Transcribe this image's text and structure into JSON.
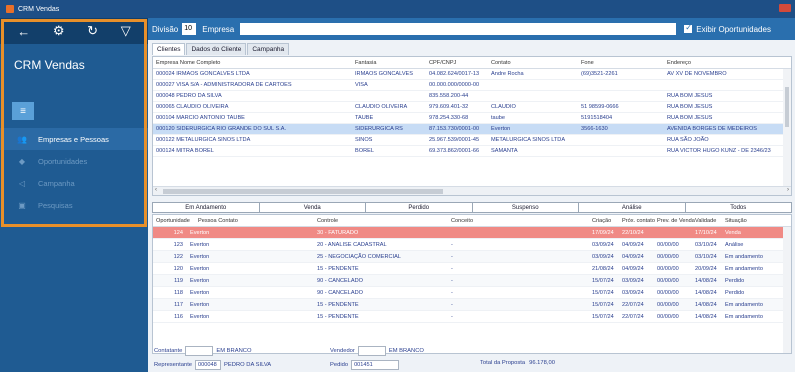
{
  "window": {
    "title": "CRM Vendas"
  },
  "sidebar": {
    "title": "CRM Vendas",
    "items": [
      {
        "label": "Empresas e Pessoas",
        "icon": "people-icon",
        "state": "active"
      },
      {
        "label": "Oportunidades",
        "icon": "diamond-icon",
        "state": "dim"
      },
      {
        "label": "Campanha",
        "icon": "megaphone-icon",
        "state": "dim"
      },
      {
        "label": "Pesquisas",
        "icon": "survey-icon",
        "state": "dim"
      }
    ]
  },
  "filters": {
    "divisao_label": "Divisão",
    "divisao_value": "10",
    "empresa_label": "Empresa",
    "exibir_label": "Exibir Oportunidades"
  },
  "tabs": [
    "Clientes",
    "Dados do Cliente",
    "Campanha"
  ],
  "clients": {
    "headers": [
      "Empresa Nome Completo",
      "Fantasia",
      "CPF/CNPJ",
      "Contato",
      "Fone",
      "Endereço"
    ],
    "rows": [
      [
        "000024  IRMAOS GONCALVES LTDA",
        "IRMAOS GONCALVES",
        "04.082.624/0017-13",
        "Andre Rocha",
        "(69)3521-2261",
        "AV XV DE NOVEMBRO"
      ],
      [
        "000027  VISA S/A - ADMINISTRADORA DE CARTOES",
        "VISA",
        "00.000.000/0000-00",
        "",
        "",
        ""
      ],
      [
        "000048  PEDRO DA SILVA",
        "",
        "835.558.200-44",
        "",
        "",
        "RUA BOM JESUS"
      ],
      [
        "000065  CLAUDIO OLIVEIRA",
        "CLAUDIO OLIVEIRA",
        "979.609.401-32",
        "CLAUDIO",
        "51 98599-0666",
        "RUA BOM JESUS"
      ],
      [
        "000104  MARCIO ANTONIO TAUBE",
        "TAUBE",
        "978.254.330-68",
        "taube",
        "5191518404",
        "RUA BOM JESUS"
      ],
      [
        "000120  SIDERURGICA RIO GRANDE DO SUL S.A.",
        "SIDERURGICA RS",
        "87.153.730/0001-00",
        "Everton",
        "3566-1630",
        "AVENIDA BORGES DE MEDEIROS"
      ],
      [
        "000122  METALURGICA SINOS LTDA",
        "SINOS",
        "25.967.539/0001-45",
        "METALURGICA SINOS LTDA",
        "",
        "RUA SÃO JOÃO"
      ],
      [
        "000124  MITRA BOREL",
        "BOREL",
        "69.373.862/0001-66",
        "SAMANTA",
        "",
        "RUA VICTOR HUGO KUNZ - DE 2346/23"
      ]
    ],
    "selected_index": 5
  },
  "status_tabs": [
    "Em Andamento",
    "Venda",
    "Perdido",
    "Suspenso",
    "Análise",
    "Todos"
  ],
  "opportunities": {
    "headers": [
      "Oportunidade",
      "Pessoa Contato",
      "Controle",
      "Conceito",
      "Criação",
      "Próx. contato",
      "Prev. de Venda",
      "Validade",
      "Situação"
    ],
    "rows": [
      [
        "124",
        "Everton",
        "30 - FATURADO",
        "",
        "17/09/24",
        "22/10/24",
        "",
        "17/10/24",
        "Venda"
      ],
      [
        "123",
        "Everton",
        "20 - ANALISE CADASTRAL",
        "-",
        "03/09/24",
        "04/09/24",
        "00/00/00",
        "03/10/24",
        "Análise"
      ],
      [
        "122",
        "Everton",
        "25 - NEGOCIAÇÃO COMERCIAL",
        "-",
        "03/09/24",
        "04/09/24",
        "00/00/00",
        "03/10/24",
        "Em andamento"
      ],
      [
        "120",
        "Everton",
        "15 - PENDENTE",
        "-",
        "21/08/24",
        "04/09/24",
        "00/00/00",
        "20/09/24",
        "Em andamento"
      ],
      [
        "119",
        "Everton",
        "90 - CANCELADO",
        "-",
        "15/07/24",
        "03/09/24",
        "00/00/00",
        "14/08/24",
        "Perdido"
      ],
      [
        "118",
        "Everton",
        "90 - CANCELADO",
        "-",
        "15/07/24",
        "03/09/24",
        "00/00/00",
        "14/08/24",
        "Perdido"
      ],
      [
        "117",
        "Everton",
        "15 - PENDENTE",
        "-",
        "15/07/24",
        "22/07/24",
        "00/00/00",
        "14/08/24",
        "Em andamento"
      ],
      [
        "116",
        "Everton",
        "15 - PENDENTE",
        "-",
        "15/07/24",
        "22/07/24",
        "00/00/00",
        "14/08/24",
        "Em andamento"
      ]
    ],
    "alert_index": 0
  },
  "footer": {
    "contatante_label": "Contatante",
    "contatante_value": "EM BRANCO",
    "vendedor_label": "Vendedor",
    "vendedor_value": "EM BRANCO",
    "representante_label": "Representante",
    "representante_code": "000048",
    "representante_name": "PEDRO DA SILVA",
    "pedido_label": "Pedido",
    "pedido_value": "001451",
    "total_label": "Total da Proposta",
    "total_value": "96.178,00"
  }
}
